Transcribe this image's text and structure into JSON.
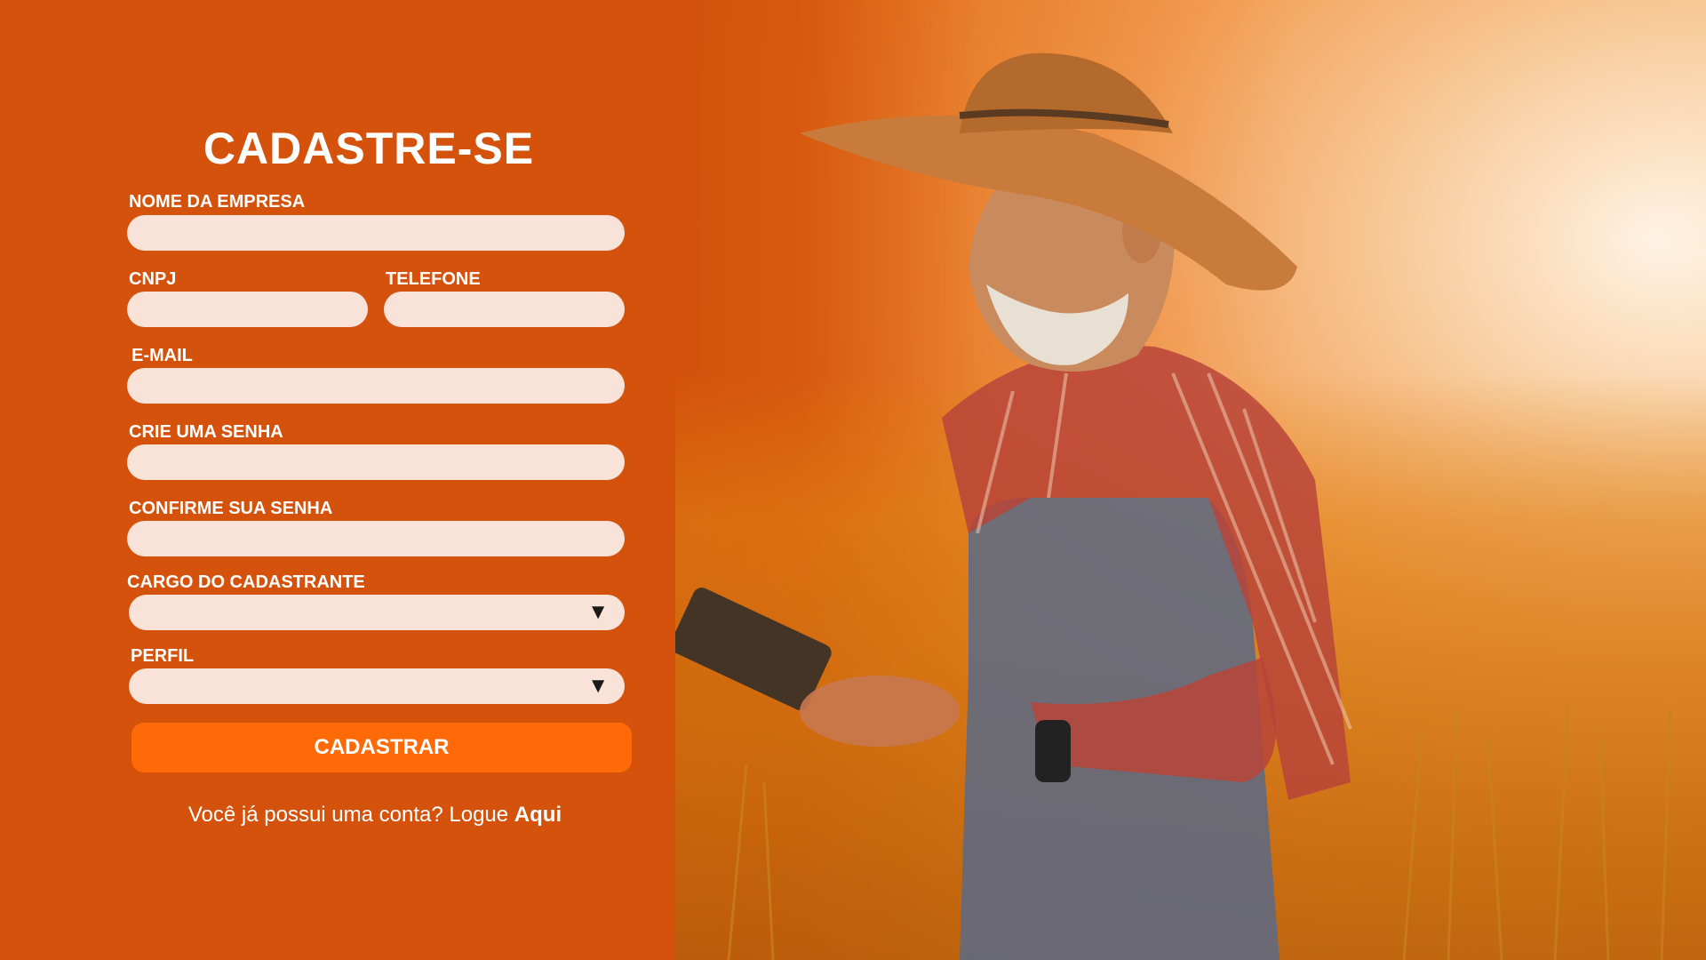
{
  "form": {
    "title": "CADASTRE-SE",
    "fields": {
      "company_name": {
        "label": "NOME DA EMPRESA",
        "value": ""
      },
      "cnpj": {
        "label": "CNPJ",
        "value": ""
      },
      "phone": {
        "label": "TELEFONE",
        "value": ""
      },
      "email": {
        "label": "E-MAIL",
        "value": ""
      },
      "password": {
        "label": "CRIE UMA SENHA",
        "value": ""
      },
      "confirm_password": {
        "label": "CONFIRME SUA SENHA",
        "value": ""
      },
      "role": {
        "label": "CARGO DO CADASTRANTE",
        "value": "",
        "arrow": "▼"
      },
      "profile": {
        "label": "PERFIL",
        "value": "",
        "arrow": "▼"
      }
    },
    "submit_label": "CADASTRAR",
    "login_prompt": "Você já possui uma conta? Logue",
    "login_link": "Aqui"
  },
  "colors": {
    "background": "#d4520b",
    "input_fill": "#f9e3d8",
    "button": "#ff6a08",
    "text": "#ffffff"
  },
  "hero": {
    "icon": "farmer-photo"
  }
}
